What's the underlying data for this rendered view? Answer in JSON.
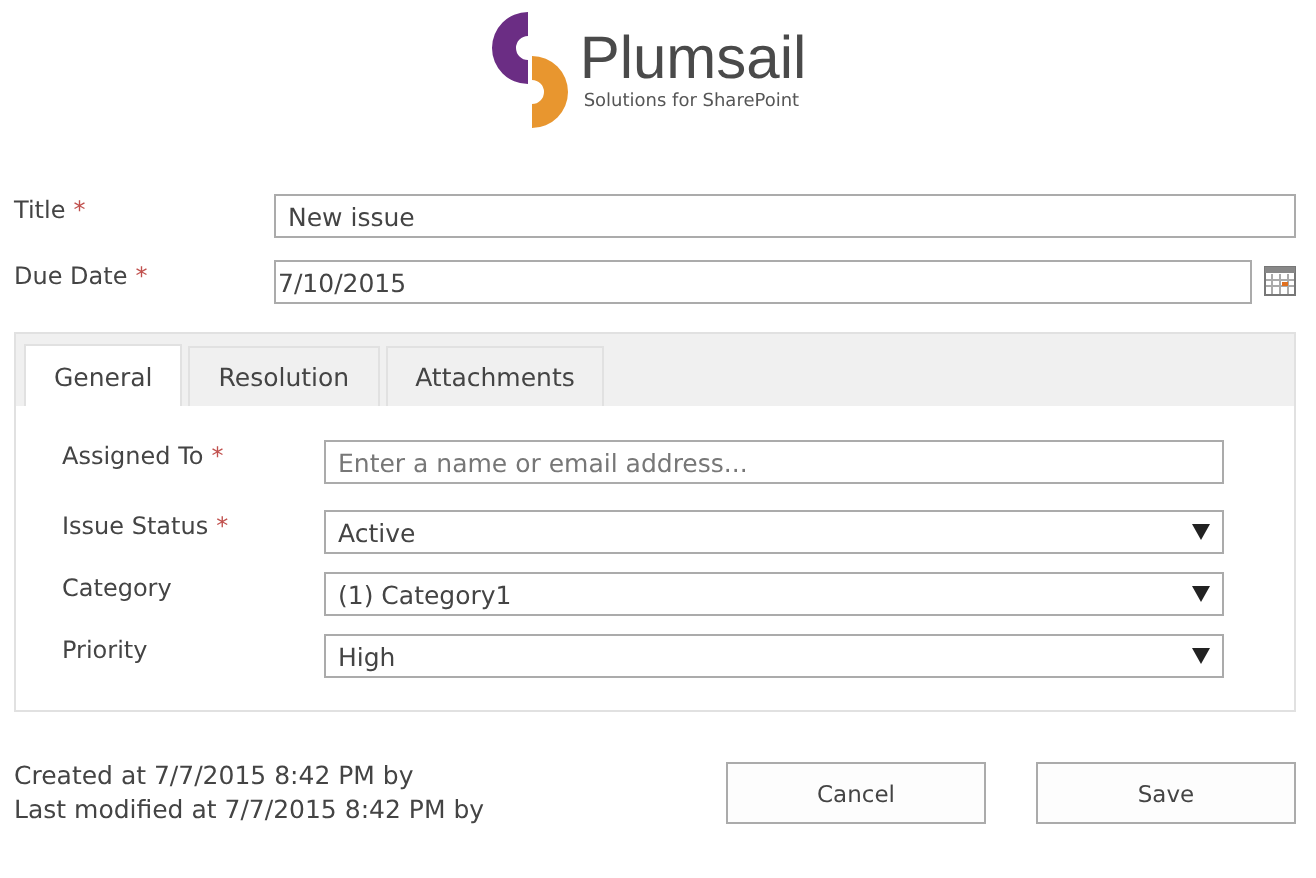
{
  "logo": {
    "name": "Plumsail",
    "tagline": "Solutions for SharePoint"
  },
  "fields": [
    {
      "label": "Title",
      "required_mark": "*",
      "kind": "text",
      "value": "New issue"
    },
    {
      "label": "Due Date",
      "required_mark": "*",
      "kind": "date",
      "value": "7/10/2015"
    }
  ],
  "tabs": [
    {
      "label": "General",
      "selected": true
    },
    {
      "label": "Resolution",
      "selected": false
    },
    {
      "label": "Attachments",
      "selected": false
    }
  ],
  "tab_fields": [
    {
      "label": "Assigned To",
      "required_mark": "*",
      "kind": "people",
      "placeholder": "Enter a name or email address..."
    },
    {
      "label": "Issue Status",
      "required_mark": "*",
      "kind": "select",
      "value": "Active"
    },
    {
      "label": "Category",
      "kind": "select",
      "value": "(1) Category1"
    },
    {
      "label": "Priority",
      "kind": "select",
      "value": "High"
    }
  ],
  "footer": {
    "lines": [
      "Created at 7/7/2015 8:42 PM by",
      "Last modified at 7/7/2015 8:42 PM by"
    ],
    "buttons": [
      "Cancel",
      "Save"
    ]
  }
}
